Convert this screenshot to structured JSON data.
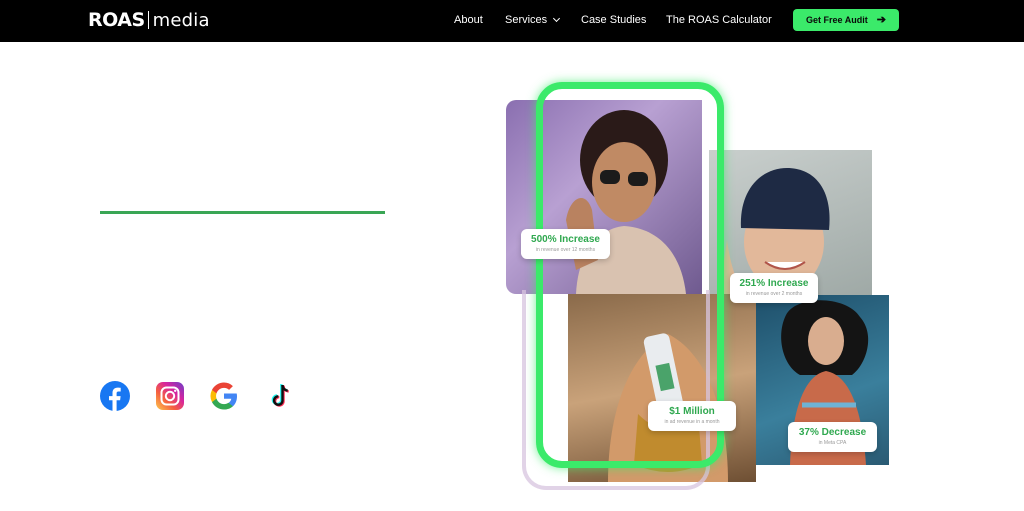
{
  "nav": {
    "logo": {
      "mark": "ROAS",
      "word": "media"
    },
    "links": [
      {
        "label": "About"
      },
      {
        "label": "Services",
        "has_dropdown": true
      },
      {
        "label": "Case Studies"
      },
      {
        "label": "The ROAS Calculator"
      }
    ],
    "cta": {
      "label": "Get Free Audit",
      "icon": "arrow-right-icon"
    }
  },
  "social": [
    {
      "name": "facebook-icon",
      "color": "#1877f2"
    },
    {
      "name": "instagram-icon",
      "color": "#d6249f"
    },
    {
      "name": "google-icon",
      "color": "#4285f4"
    },
    {
      "name": "tiktok-icon",
      "color": "#000000"
    }
  ],
  "stats": [
    {
      "value": "500% Increase",
      "note": "in revenue over 12 months"
    },
    {
      "value": "251% Increase",
      "note": "in revenue over 2 months"
    },
    {
      "value": "$1 Million",
      "note": "in ad revenue in a month"
    },
    {
      "value": "37% Decrease",
      "note": "in Meta CPA"
    }
  ],
  "colors": {
    "accent": "#3bea6a",
    "nav_bg": "#000000",
    "stat_green": "#2fa84f",
    "divider": "#3aa655"
  }
}
